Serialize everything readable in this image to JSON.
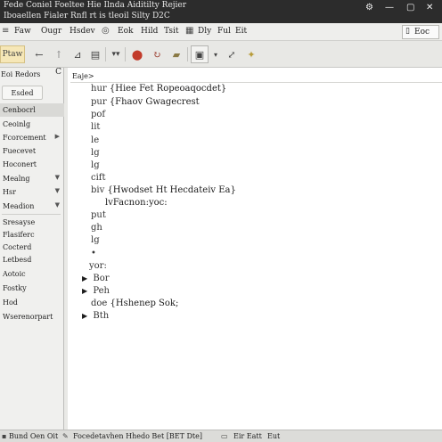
{
  "window": {
    "title_line1": "Fede Coniel Foeltee Hie Ilnda Aiditilty Rejier",
    "title_line2": "Iboaellen Fialer Rnfl rt is tleoil Silty D2C",
    "controls": [
      "⚙",
      "—",
      "▢",
      "✕"
    ]
  },
  "menubar": {
    "items": [
      "Faw",
      "Ougr",
      "Hsdev",
      "Eok",
      "Hild",
      "Tsit",
      "Dly",
      "Ful",
      "Eit"
    ],
    "right_label": "Eoc"
  },
  "toolbar": {
    "first_label": "Ptaw",
    "icons": [
      "arrow-left-icon",
      "arrow-up-icon",
      "tag-icon",
      "list-icon",
      "menu-more-icon",
      "stop-icon",
      "refresh-icon",
      "folder-icon",
      "image-icon",
      "dropdown-icon",
      "expand-icon",
      "star-icon"
    ]
  },
  "sidebar": {
    "header": "Eoi Redors",
    "header_button": "C",
    "top_button": "Esded",
    "items": [
      {
        "label": "Cenbocrl",
        "selected": true,
        "arrow": false
      },
      {
        "label": "Ceoinlg",
        "selected": false,
        "arrow": false
      },
      {
        "label": "Fcorcement",
        "selected": false,
        "arrow": true
      },
      {
        "label": "Fuecevet",
        "selected": false,
        "arrow": false
      },
      {
        "label": "Hoconert",
        "selected": false,
        "arrow": false
      },
      {
        "label": "Mealng",
        "selected": false,
        "arrow": true
      },
      {
        "label": "Hsr",
        "selected": false,
        "arrow": true
      },
      {
        "label": "Meadion",
        "selected": false,
        "arrow": true
      },
      {
        "label": "Sresayse",
        "selected": false,
        "arrow": false
      },
      {
        "label": "Flasiferc",
        "selected": false,
        "arrow": false
      },
      {
        "label": "Cocterd",
        "selected": false,
        "arrow": false
      },
      {
        "label": "Letbesd",
        "selected": false,
        "arrow": false
      },
      {
        "label": "Aotoic",
        "selected": false,
        "arrow": false
      },
      {
        "label": "Fostky",
        "selected": false,
        "arrow": false
      },
      {
        "label": "Hod",
        "selected": false,
        "arrow": false
      },
      {
        "label": "Wserenorpart",
        "selected": false,
        "arrow": false
      }
    ]
  },
  "content": {
    "breadcrumb": "Eaje>",
    "lines": [
      {
        "kw": "hur",
        "text": "{Hiee Fet Ropeoaqocdet}",
        "tri": false
      },
      {
        "kw": "pur",
        "text": "{Fhaov Gwagecrest",
        "tri": false
      },
      {
        "kw": "pof",
        "text": "",
        "tri": false
      },
      {
        "kw": "lit",
        "text": "",
        "tri": false
      },
      {
        "kw": "le",
        "text": "",
        "tri": false
      },
      {
        "kw": "lg",
        "text": "",
        "tri": false
      },
      {
        "kw": "lg",
        "text": "",
        "tri": false
      },
      {
        "kw": "cift",
        "text": "",
        "tri": false
      },
      {
        "kw": "biv",
        "text": "{Hwodset Ht Hecdateiv Ea}",
        "tri": false
      },
      {
        "kw": "",
        "text": "lvFacnon:yoc:",
        "tri": false
      },
      {
        "kw": "put",
        "text": "",
        "tri": false
      },
      {
        "kw": "gh",
        "text": "",
        "tri": false
      },
      {
        "kw": "lg",
        "text": "",
        "tri": false
      },
      {
        "kw": "•",
        "text": "",
        "tri": false
      },
      {
        "kw": "yor:",
        "text": "",
        "tri": false
      },
      {
        "kw": "Bor",
        "text": "",
        "tri": true
      },
      {
        "kw": "Peh",
        "text": "",
        "tri": true
      },
      {
        "kw": "doe",
        "text": "{Hshenep Sok;",
        "tri": false
      },
      {
        "kw": "Bth",
        "text": "",
        "tri": true
      }
    ]
  },
  "statusbar": {
    "left": "Bund Oen Oit",
    "middle": "Focedetavhen Hhedo Bet [BET Dte]",
    "right1": "Eir Eatt",
    "right2": "Eut"
  }
}
